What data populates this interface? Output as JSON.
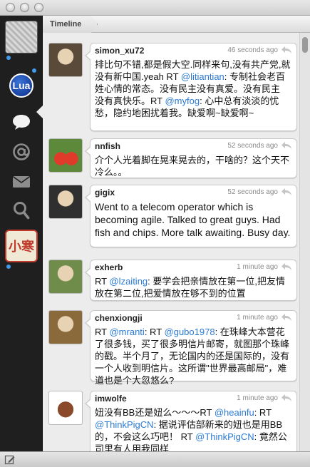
{
  "header": {
    "crumb": "Timeline"
  },
  "sidebar": {
    "items": [
      {
        "name": "account-avatar",
        "icon": "account-avatar"
      },
      {
        "name": "lua-account",
        "label": "Lua"
      },
      {
        "name": "timeline",
        "icon": "speech-bubble-icon"
      },
      {
        "name": "mentions",
        "icon": "at-sign-icon"
      },
      {
        "name": "messages",
        "icon": "envelope-icon"
      },
      {
        "name": "search",
        "icon": "search-icon"
      },
      {
        "name": "seal-account",
        "label": "小寒"
      }
    ]
  },
  "colors": {
    "link": "#2a7bd6",
    "dot": "#3d9bf0"
  },
  "tweets": [
    {
      "user": "simon_xu72",
      "time": "46 seconds ago",
      "segments": [
        {
          "t": "排比句不错,都是假大空.同样来句,没有共产党,就没有新中国.yeah RT "
        },
        {
          "t": "@litiantian",
          "link": true
        },
        {
          "t": ": 专制社会老百姓心情的常态。没有民主没有真爱。没有民主 没有真快乐。RT "
        },
        {
          "t": "@myfog",
          "link": true
        },
        {
          "t": ": 心中总有淡淡的忧愁，隐约地困扰着我。缺爱啊~缺爱啊~"
        }
      ]
    },
    {
      "user": "nnfish",
      "time": "52 seconds ago",
      "segments": [
        {
          "t": "介个人光着脚在晃来晃去的，干啥的？这个天不冷么。。"
        }
      ]
    },
    {
      "user": "gigix",
      "time": "52 seconds ago",
      "segments": [
        {
          "t": "Went to a telecom operator which is becoming agile. Talked to great guys. Had fish and chips. More talk awaiting. Busy day."
        }
      ]
    },
    {
      "user": "exherb",
      "time": "1 minute ago",
      "segments": [
        {
          "t": "RT "
        },
        {
          "t": "@lzaiting",
          "link": true
        },
        {
          "t": ": 要学会把亲情放在第一位,把友情放在第二位,把爱情放在够不到的位置"
        }
      ]
    },
    {
      "user": "chenxiongji",
      "time": "1 minute ago",
      "segments": [
        {
          "t": "RT "
        },
        {
          "t": "@mranti",
          "link": true
        },
        {
          "t": ": RT "
        },
        {
          "t": "@gubo1978",
          "link": true
        },
        {
          "t": ": 在珠峰大本营花了很多钱，买了很多明信片邮寄，就图那个珠峰的戳。半个月了，无论国内的还是国际的，没有一个人收到明信片。这所谓\"世界最高邮局\"，难道也是个大忽悠么?"
        }
      ]
    },
    {
      "user": "imwolfe",
      "time": "1 minute ago",
      "segments": [
        {
          "t": "妞没有BB还是妞么～～～RT "
        },
        {
          "t": "@heainfu",
          "link": true
        },
        {
          "t": ": RT "
        },
        {
          "t": "@ThinkPigCN",
          "link": true
        },
        {
          "t": ": 据说评估部新来的妞也是用BB的，不会这么巧吧！ RT "
        },
        {
          "t": "@ThinkPigCN",
          "link": true
        },
        {
          "t": ": 竟然公司里有人用我同样"
        }
      ]
    }
  ]
}
